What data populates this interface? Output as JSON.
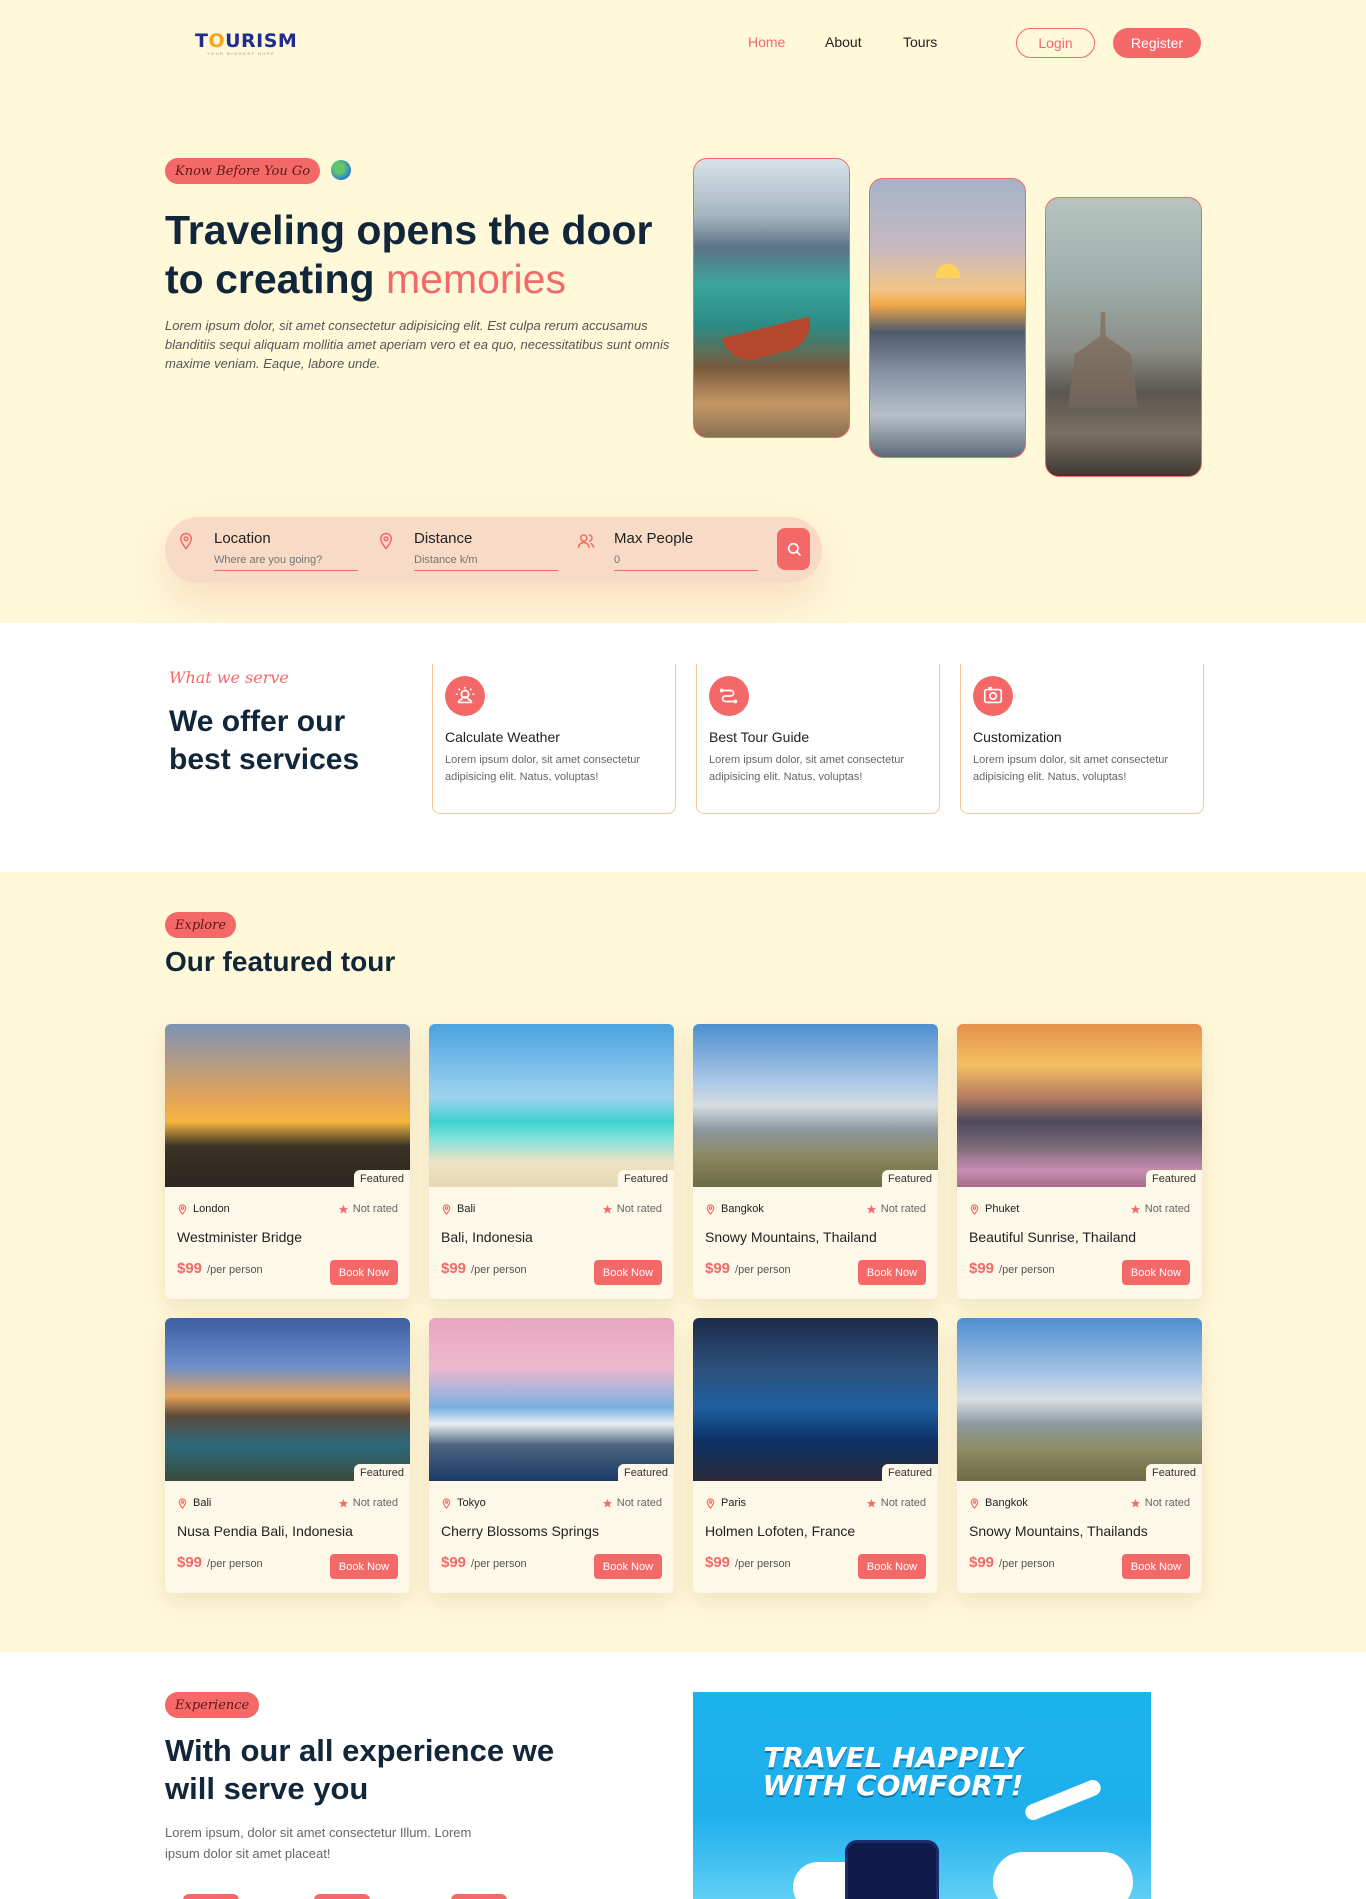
{
  "nav": {
    "logo_text_pre": "T",
    "logo_text_o": "O",
    "logo_text_post": "URISM",
    "logo_sub": "YOUR BIGGEST HOPE",
    "links": [
      "Home",
      "About",
      "Tours"
    ],
    "login": "Login",
    "register": "Register"
  },
  "hero": {
    "pill": "Know Before You Go",
    "title_line1": "Traveling opens the door",
    "title_line2_pre": "to creating ",
    "title_line2_accent": "memories",
    "description": "Lorem ipsum dolor, sit amet consectetur adipisicing elit. Est culpa rerum accusamus blanditiis sequi aliquam mollitia amet aperiam vero et ea quo, necessitatibus sunt omnis maxime veniam. Eaque, labore unde."
  },
  "search": {
    "location_label": "Location",
    "location_placeholder": "Where are you going?",
    "distance_label": "Distance",
    "distance_placeholder": "Distance k/m",
    "people_label": "Max People",
    "people_placeholder": "0"
  },
  "services": {
    "kicker": "What we serve",
    "title": "We offer our best services",
    "cards": [
      {
        "title": "Calculate Weather",
        "desc": "Lorem ipsum dolor, sit amet consectetur adipisicing elit. Natus, voluptas!",
        "icon": "weather-icon"
      },
      {
        "title": "Best Tour Guide",
        "desc": "Lorem ipsum dolor, sit amet consectetur adipisicing elit. Natus, voluptas!",
        "icon": "guide-icon"
      },
      {
        "title": "Customization",
        "desc": "Lorem ipsum dolor, sit amet consectetur adipisicing elit. Natus, voluptas!",
        "icon": "customize-icon"
      }
    ]
  },
  "featured": {
    "pill": "Explore",
    "title": "Our featured tour",
    "badge": "Featured",
    "rating": "Not rated",
    "per_person": "/per person",
    "book": "Book Now",
    "tours": [
      {
        "city": "London",
        "name": "Westminister Bridge",
        "price": "$99"
      },
      {
        "city": "Bali",
        "name": "Bali, Indonesia",
        "price": "$99"
      },
      {
        "city": "Bangkok",
        "name": "Snowy Mountains, Thailand",
        "price": "$99"
      },
      {
        "city": "Phuket",
        "name": "Beautiful Sunrise, Thailand",
        "price": "$99"
      },
      {
        "city": "Bali",
        "name": "Nusa Pendia Bali, Indonesia",
        "price": "$99"
      },
      {
        "city": "Tokyo",
        "name": "Cherry Blossoms Springs",
        "price": "$99"
      },
      {
        "city": "Paris",
        "name": "Holmen Lofoten, France",
        "price": "$99"
      },
      {
        "city": "Bangkok",
        "name": "Snowy Mountains, Thailands",
        "price": "$99"
      }
    ]
  },
  "experience": {
    "pill": "Experience",
    "title": "With our all experience we will serve you",
    "description": "Lorem ipsum, dolor sit amet consectetur Illum. Lorem ipsum dolor sit amet placeat!",
    "banner_line1": "TRAVEL HAPPILY",
    "banner_line2": "WITH COMFORT!"
  },
  "colors": {
    "accent": "#f56868",
    "cream": "#fff8d9",
    "navy": "#1e2d8f"
  }
}
